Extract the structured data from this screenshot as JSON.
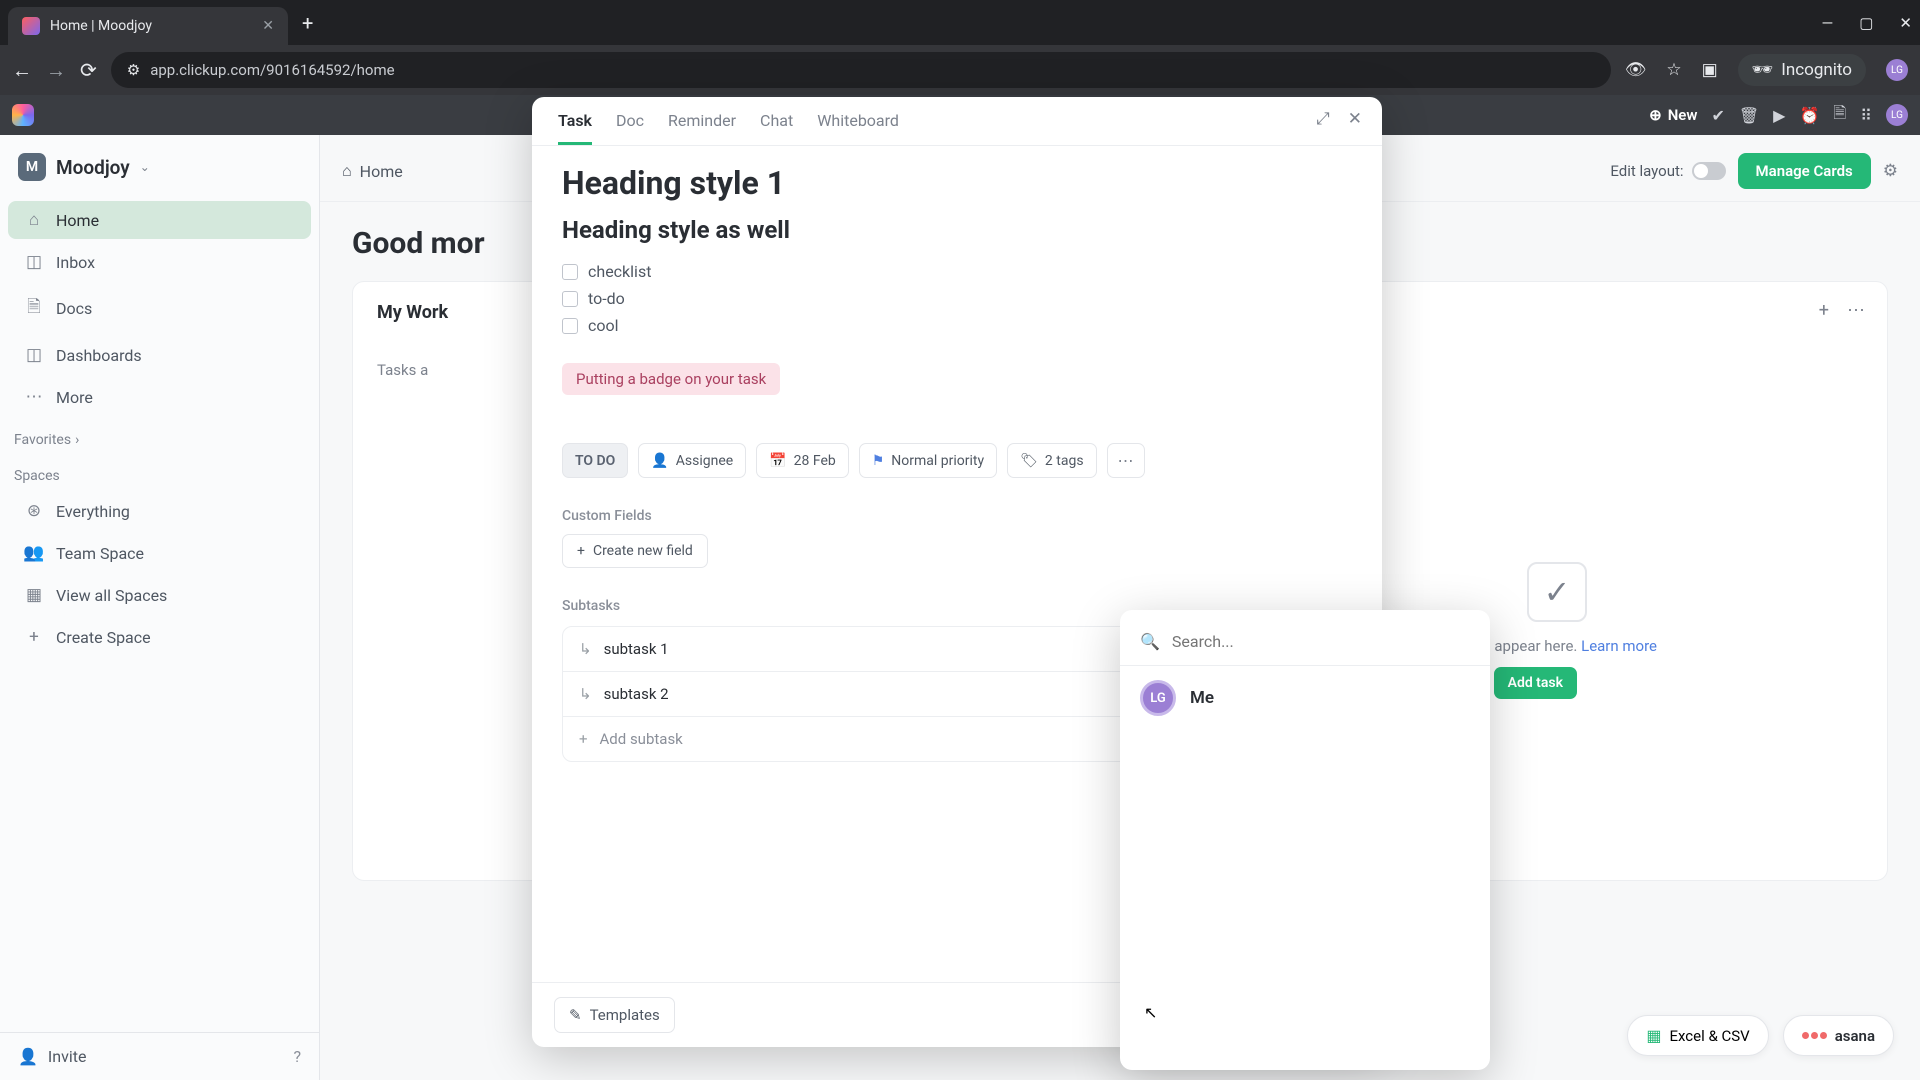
{
  "browser": {
    "tab_title": "Home | Moodjoy",
    "url": "app.clickup.com/9016164592/home",
    "incognito_label": "Incognito",
    "avatar_initials": "LG"
  },
  "topbar": {
    "new_label": "New"
  },
  "sidebar": {
    "workspace": {
      "badge": "M",
      "name": "Moodjoy"
    },
    "nav": [
      "Home",
      "Inbox",
      "Docs",
      "Dashboards",
      "More"
    ],
    "favorites_label": "Favorites",
    "spaces_label": "Spaces",
    "spaces": [
      "Everything",
      "Team Space",
      "View all Spaces",
      "Create Space"
    ],
    "invite_label": "Invite"
  },
  "main": {
    "breadcrumb": "Home",
    "edit_layout_label": "Edit layout:",
    "manage_cards": "Manage Cards",
    "greeting": "Good mor",
    "panel_title": "My Work",
    "tasks_prefix": "Tasks a",
    "empty_suffix": "will appear here.",
    "learn_more": "Learn more",
    "add_task": "Add task"
  },
  "pills": {
    "excel": "Excel & CSV",
    "asana": "asana"
  },
  "modal": {
    "tabs": [
      "Task",
      "Doc",
      "Reminder",
      "Chat",
      "Whiteboard"
    ],
    "heading1": "Heading style 1",
    "heading2": "Heading style as well",
    "checklist": [
      "checklist",
      "to-do",
      "cool"
    ],
    "badge": "Putting a badge on your task",
    "chips": {
      "status": "TO DO",
      "assignee": "Assignee",
      "date": "28 Feb",
      "priority": "Normal priority",
      "tags": "2 tags"
    },
    "custom_fields_label": "Custom Fields",
    "create_field": "Create new field",
    "subtasks_label": "Subtasks",
    "subtasks": [
      "subtask 1",
      "subtask 2"
    ],
    "add_subtask": "Add subtask",
    "templates": "Templates"
  },
  "popover": {
    "search_placeholder": "Search...",
    "me_label": "Me",
    "avatar_initials": "LG"
  }
}
